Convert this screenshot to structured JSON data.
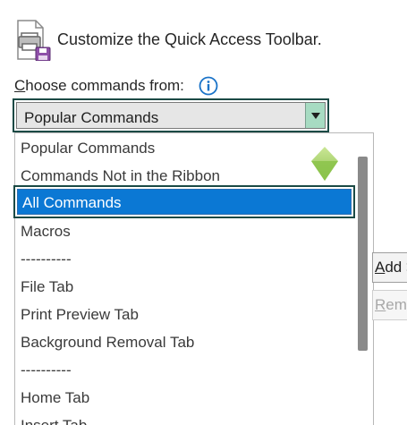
{
  "header": {
    "title": "Customize the Quick Access Toolbar.",
    "icon": "toolbar-printer-save-icon"
  },
  "choose": {
    "label_accel": "C",
    "label_rest": "hoose commands from:",
    "info_icon": "info-icon"
  },
  "combo": {
    "value": "Popular Commands"
  },
  "dropdown": {
    "items": [
      "Popular Commands",
      "Commands Not in the Ribbon",
      "All Commands",
      "Macros",
      "----------",
      "File Tab",
      "Print Preview Tab",
      "Background Removal Tab",
      "----------",
      "Home Tab",
      "Insert Tab"
    ],
    "selected_index": 2
  },
  "side_buttons": {
    "add_accel": "A",
    "add_rest": "dd >",
    "remove_accel": "R",
    "remove_rest": "em"
  },
  "colors": {
    "accent_border": "#1b4a45",
    "selected_bg": "#0b78d4",
    "combo_arrow_bg": "#a7dbc2",
    "green_arrow": "#8bc34a"
  }
}
